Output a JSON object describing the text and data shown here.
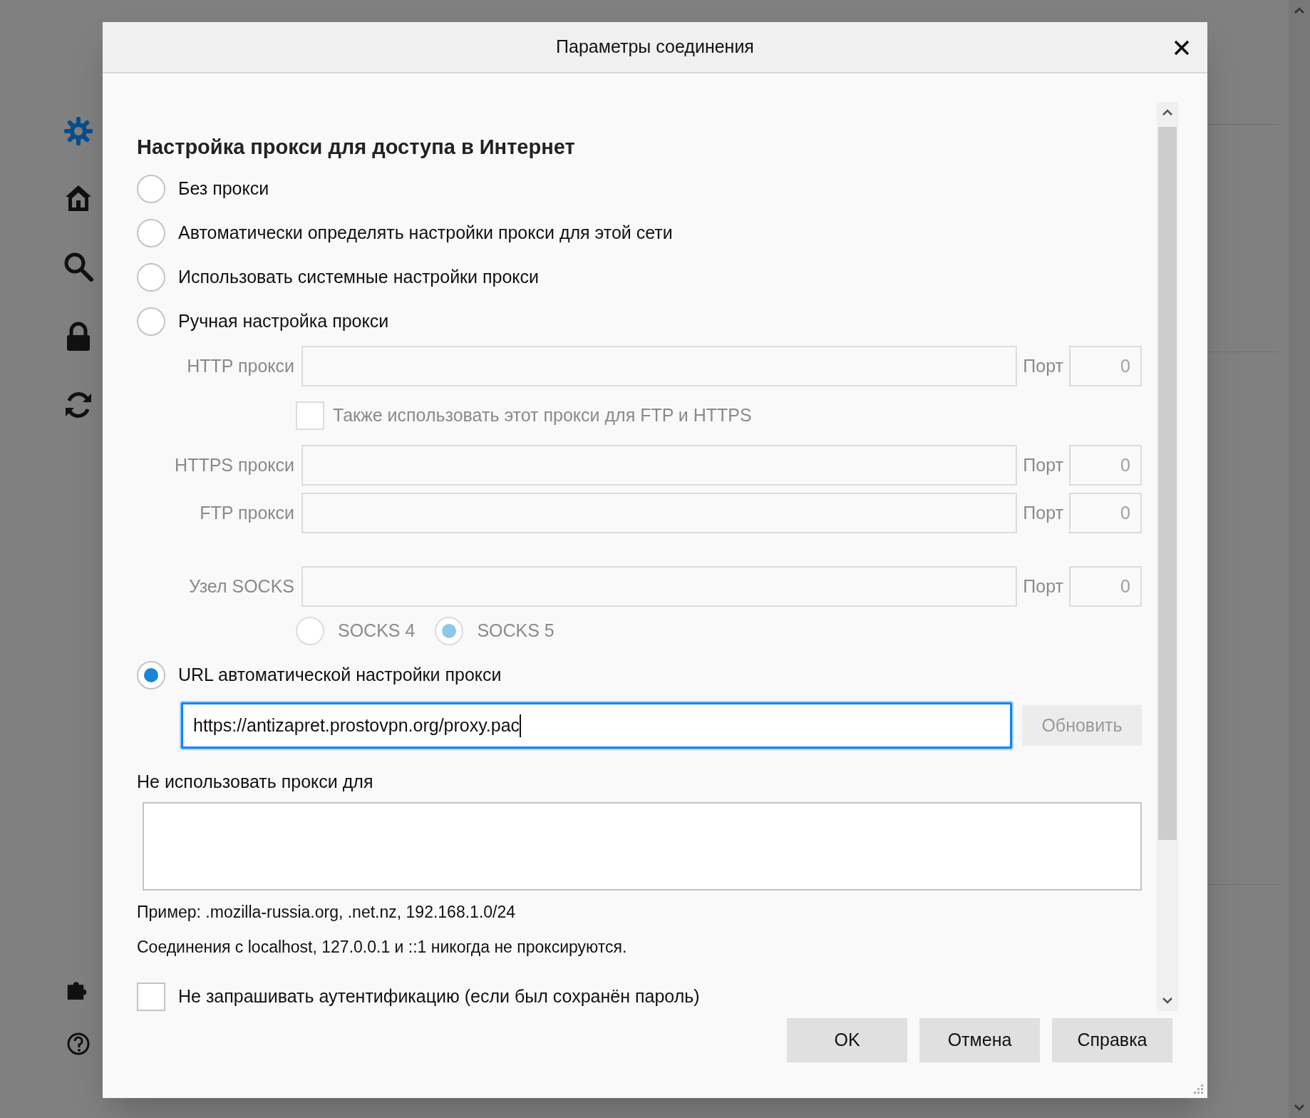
{
  "sidebar": {
    "items": [
      {
        "kind": "gear",
        "selected": true
      },
      {
        "kind": "home",
        "selected": false
      },
      {
        "kind": "search",
        "selected": false
      },
      {
        "kind": "lock",
        "selected": false
      },
      {
        "kind": "sync",
        "selected": false
      },
      {
        "kind": "puzzle",
        "selected": false
      },
      {
        "kind": "help",
        "selected": false
      }
    ]
  },
  "dialog": {
    "title": "Параметры соединения",
    "section_title": "Настройка прокси для доступа в Интернет",
    "proxy_modes": [
      {
        "label": "Без прокси",
        "selected": false
      },
      {
        "label": "Автоматически определять настройки прокси для этой сети",
        "selected": false
      },
      {
        "label": "Использовать системные настройки прокси",
        "selected": false
      },
      {
        "label": "Ручная настройка прокси",
        "selected": false,
        "disabled_fields": true,
        "groups": [
          [
            {
              "kind": "host",
              "label": "HTTP прокси",
              "port_label": "Порт",
              "port_value": "0"
            },
            {
              "kind": "checkbox",
              "label": "Также использовать этот прокси для FTP и HTTPS",
              "checked": false
            },
            {
              "kind": "host",
              "label": "HTTPS прокси",
              "port_label": "Порт",
              "port_value": "0"
            },
            {
              "kind": "host",
              "label": "FTP прокси",
              "port_label": "Порт",
              "port_value": "0"
            }
          ],
          [
            {
              "kind": "host",
              "label": "Узел SOCKS",
              "port_label": "Порт",
              "port_value": "0"
            },
            {
              "kind": "versions",
              "options": [
                {
                  "label": "SOCKS 4",
                  "selected": false
                },
                {
                  "label": "SOCKS 5",
                  "selected": true
                }
              ]
            }
          ]
        ]
      },
      {
        "label": "URL автоматической настройки прокси",
        "selected": true,
        "url": {
          "value": "https://antizapret.prostovpn.org/proxy.pac",
          "focused": true
        },
        "reload": {
          "label": "Обновить",
          "disabled": true
        }
      }
    ],
    "no_proxy": {
      "label": "Не использовать прокси для"
    },
    "example": "Пример: .mozilla-russia.org, .net.nz, 192.168.1.0/24",
    "note": "Соединения с localhost, 127.0.0.1 и ::1 никогда не проксируются.",
    "no_auth": {
      "label": "Не запрашивать аутентификацию (если был сохранён пароль)",
      "checked": false
    },
    "buttons": [
      {
        "label": "OK"
      },
      {
        "label": "Отмена"
      },
      {
        "label": "Справка"
      }
    ]
  }
}
